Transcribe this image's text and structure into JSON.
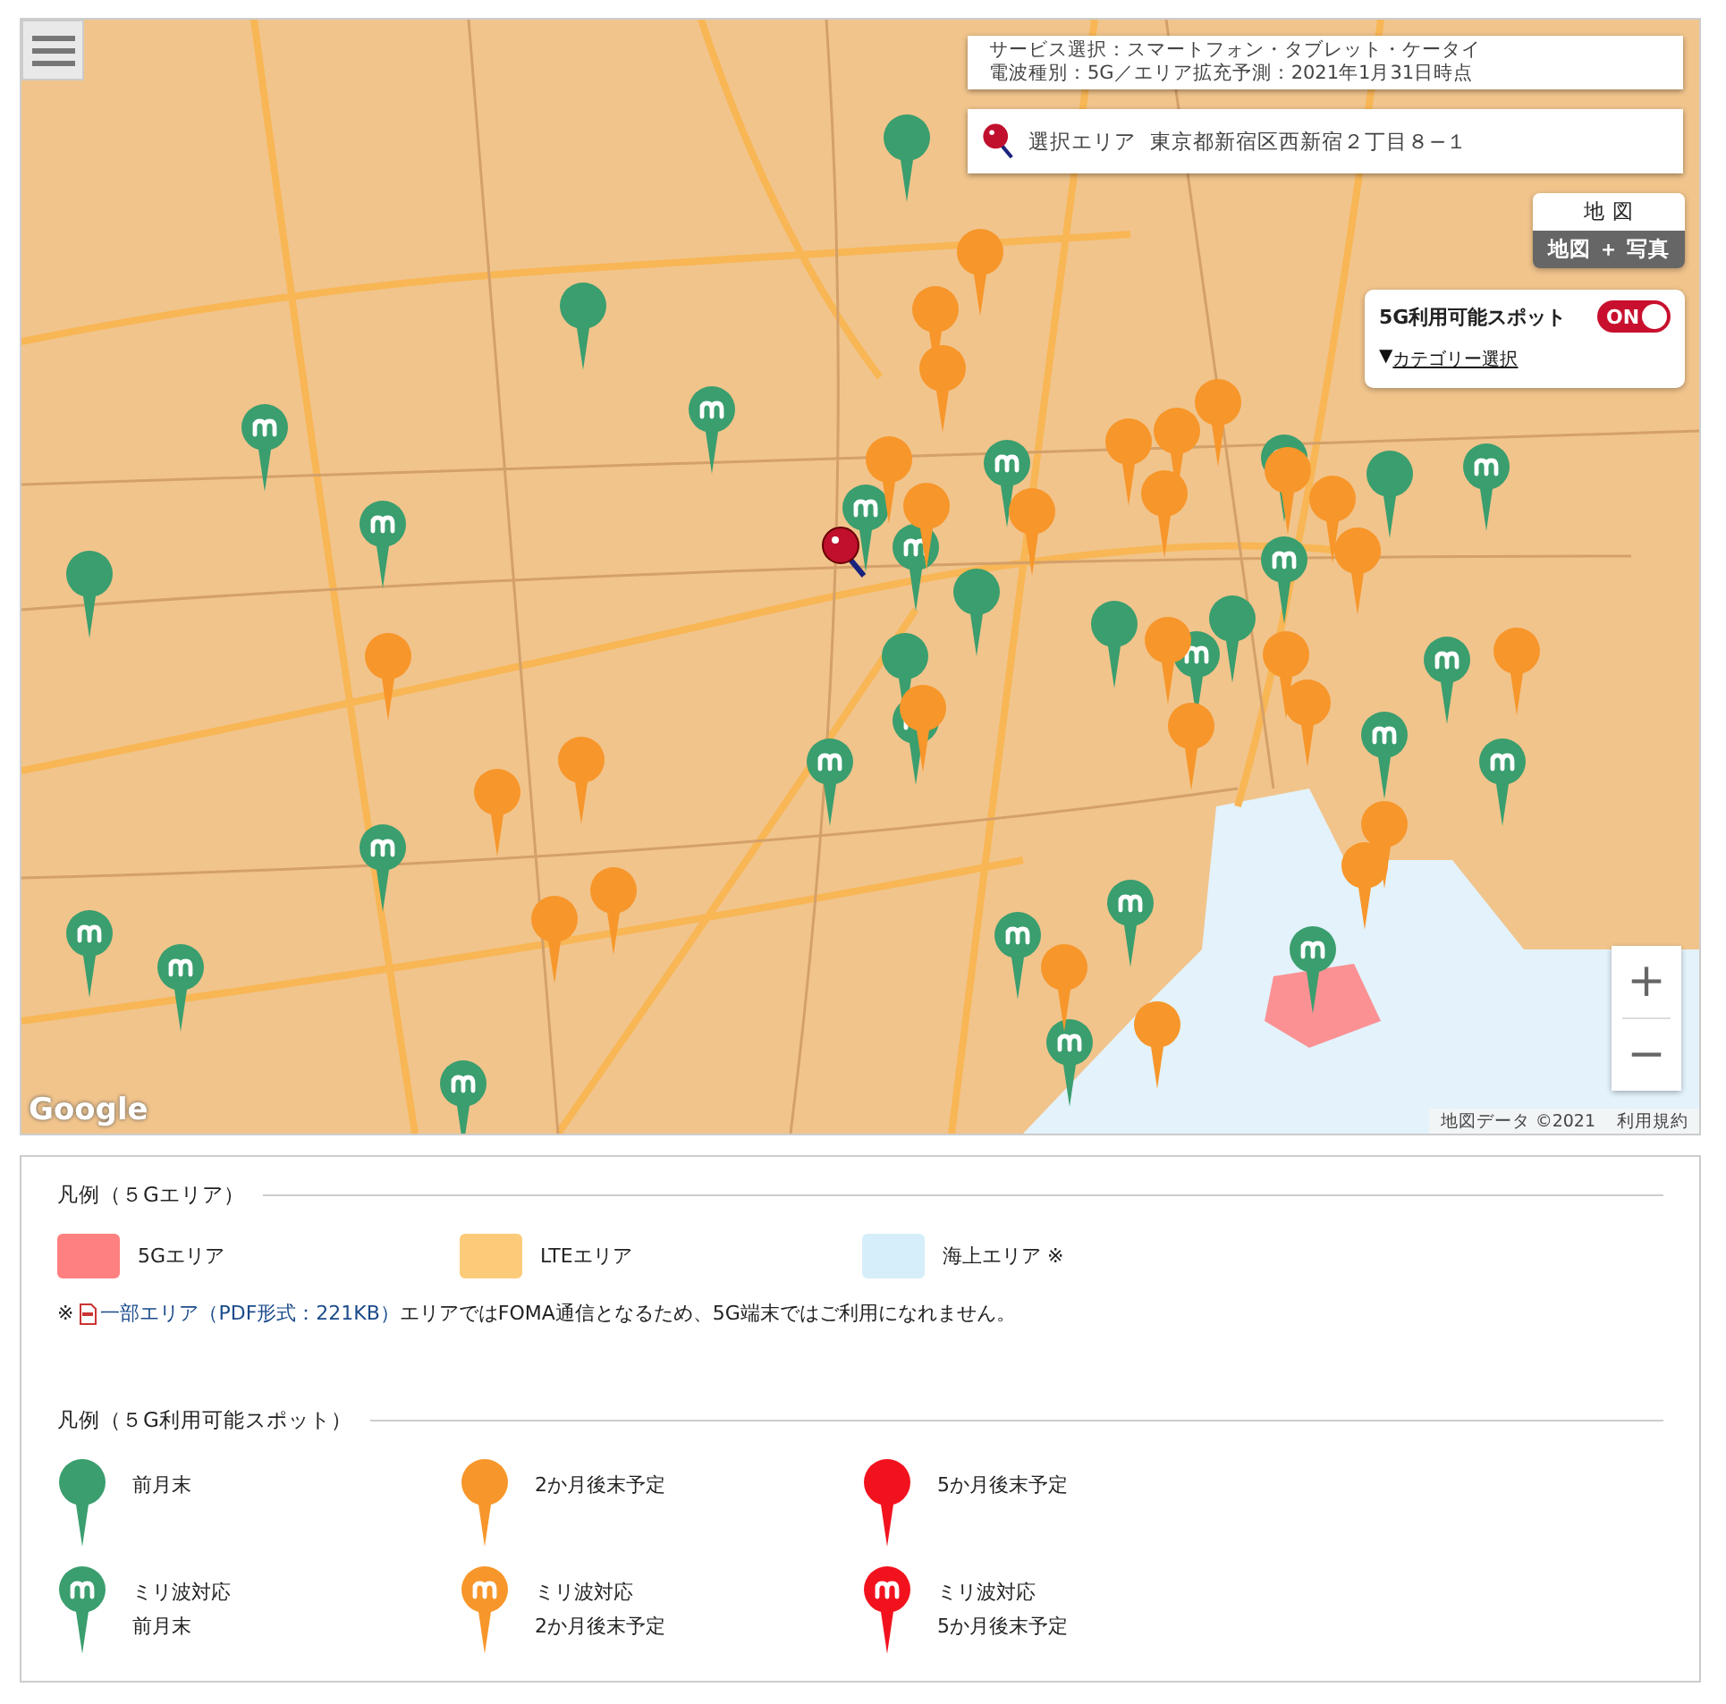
{
  "map": {
    "info_lines": [
      "サービス選択：スマートフォン・タブレット・ケータイ",
      "電波種別：5G／エリア拡充予測：2021年1月31日時点"
    ],
    "selected_area": {
      "label": "選択エリア",
      "address": "東京都新宿区西新宿２丁目８−１"
    },
    "map_types": [
      {
        "label": "地 図",
        "selected": true
      },
      {
        "label": "地図 ＋ 写真",
        "selected": false
      }
    ],
    "spot_toggle": {
      "label": "5G利用可能スポット",
      "on": true,
      "state_text": "ON"
    },
    "category": {
      "arrow": "▼",
      "label": "カテゴリー選択"
    },
    "zoom": {
      "in": "+",
      "out": "−"
    },
    "logo": "Google",
    "attribution": "地図データ ©2021",
    "terms": "利用規約"
  },
  "legend_area": {
    "title": "凡例（５Gエリア）",
    "items": [
      {
        "label": "5Gエリア",
        "color": "#ff8080"
      },
      {
        "label": "LTEエリア",
        "color": "#fccb7a"
      },
      {
        "label": "海上エリア ※",
        "color": "#d6eefa"
      }
    ],
    "note": {
      "mark": "※",
      "link": "一部エリア（PDF形式：221KB）",
      "text": "エリアではFOMA通信となるため、5G端末ではご利用になれません。"
    }
  },
  "legend_spots": {
    "title": "凡例（５G利用可能スポット）",
    "items": [
      {
        "kind": "plain",
        "color": "#3a9e6e",
        "lines": [
          "前月末"
        ]
      },
      {
        "kind": "plain",
        "color": "#f7962a",
        "lines": [
          "2か月後末予定"
        ]
      },
      {
        "kind": "plain",
        "color": "#f2121e",
        "lines": [
          "5か月後末予定"
        ]
      },
      {
        "kind": "mmwave",
        "color": "#3a9e6e",
        "lines": [
          "ミリ波対応",
          "前月末"
        ]
      },
      {
        "kind": "mmwave",
        "color": "#f7962a",
        "lines": [
          "ミリ波対応",
          "2か月後末予定"
        ]
      },
      {
        "kind": "mmwave",
        "color": "#f2121e",
        "lines": [
          "ミリ波対応",
          "5か月後末予定"
        ]
      }
    ]
  }
}
